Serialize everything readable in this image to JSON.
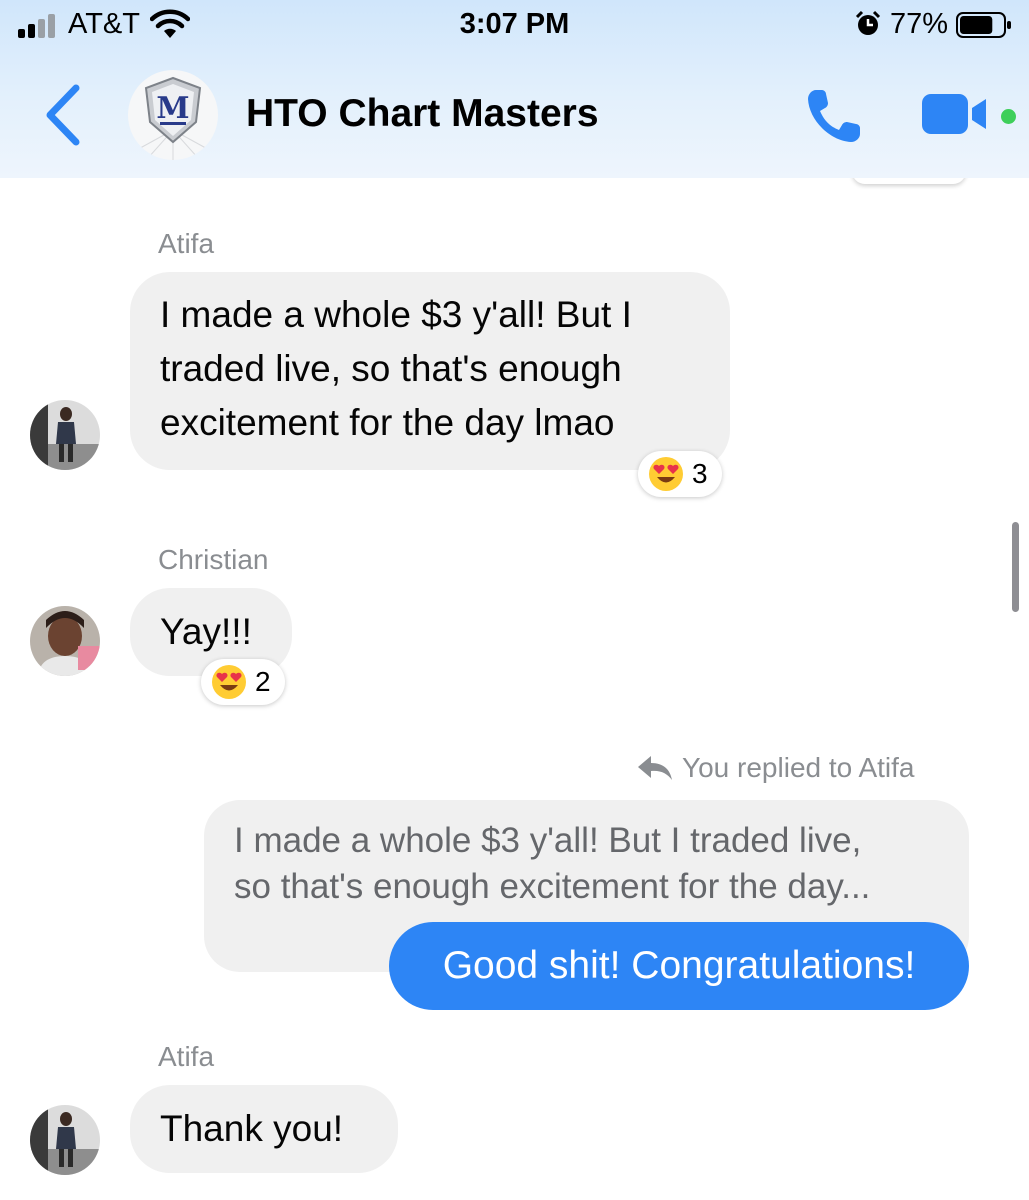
{
  "status_bar": {
    "carrier": "AT&T",
    "time": "3:07 PM",
    "battery_percent": "77%",
    "signal_bars_filled": 2,
    "battery_level": 0.77
  },
  "header": {
    "group_name": "HTO Chart Masters",
    "logo_letter": "M",
    "back_icon": "chevron-left-icon",
    "call_icon": "phone-icon",
    "video_icon": "video-camera-icon",
    "accent_color": "#2d85f5",
    "active_color": "#3ecf5a"
  },
  "messages": [
    {
      "sender": "Atifa",
      "lines": [
        "I made a whole $3 y'all! But I",
        "traded live, so that's enough",
        "excitement for the day lmao"
      ],
      "reaction": {
        "emoji": "heart-eyes-emoji",
        "count": "3"
      }
    },
    {
      "sender": "Christian",
      "lines": [
        "Yay!!!"
      ],
      "reaction": {
        "emoji": "heart-eyes-emoji",
        "count": "2"
      }
    },
    {
      "reply_note": "You replied to Atifa",
      "quoted_lines": [
        "I made a whole $3 y'all! But I traded live,",
        "so that's enough excitement for the day..."
      ],
      "text": "Good shit! Congratulations!",
      "bubble_color": "#2d85f5"
    },
    {
      "sender": "Atifa",
      "lines": [
        "Thank you!"
      ]
    }
  ]
}
